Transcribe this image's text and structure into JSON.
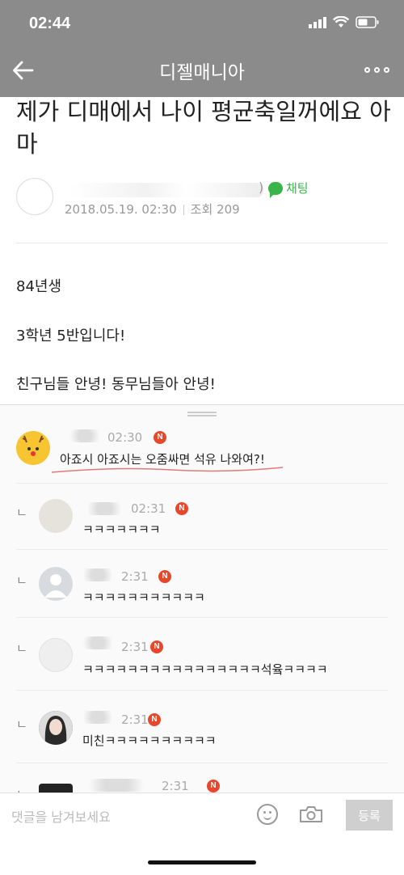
{
  "status": {
    "time": "02:44"
  },
  "nav": {
    "title": "디젤매니아"
  },
  "post": {
    "title": "제가 디매에서 나이 평균축일꺼에요 아마",
    "author_paren": ")",
    "chat_label": "채팅",
    "date": "2018.05.19. 02:30",
    "views": "조회 209",
    "body": [
      "84년생",
      "3학년 5반입니다!",
      "친구님들 안녕! 동무님들아 안녕!"
    ]
  },
  "comments": [
    {
      "time": "02:30",
      "badge": "N",
      "text": "아죠시 아죠시는 오줌싸면 석유 나와여?!",
      "reply": false
    },
    {
      "time": "02:31",
      "badge": "N",
      "text": "ㅋㅋㅋㅋㅋㅋㅋ",
      "reply": true
    },
    {
      "time": "2:31",
      "badge": "N",
      "text": "ㅋㅋㅋㅋㅋㅋㅋㅋㅋㅋㅋ",
      "reply": true
    },
    {
      "time": "2:31",
      "badge": "N",
      "text": "ㅋㅋㅋㅋㅋㅋㅋㅋㅋㅋㅋㅋㅋㅋㅋㅋ석윸ㅋㅋㅋㅋ",
      "reply": true
    },
    {
      "time": "2:31",
      "badge": "N",
      "text": "미친ㅋㅋㅋㅋㅋㅋㅋㅋㅋㅋ",
      "reply": true
    },
    {
      "time": "2:31",
      "badge": "N",
      "text": "",
      "reply": true
    }
  ],
  "reply_mark": "ㄴ",
  "input": {
    "placeholder": "댓글을 남겨보세요",
    "submit_label": "등록"
  },
  "colors": {
    "topbar": "#8b8b8b",
    "chat_green": "#3ab54a",
    "badge_red": "#e8472b"
  }
}
